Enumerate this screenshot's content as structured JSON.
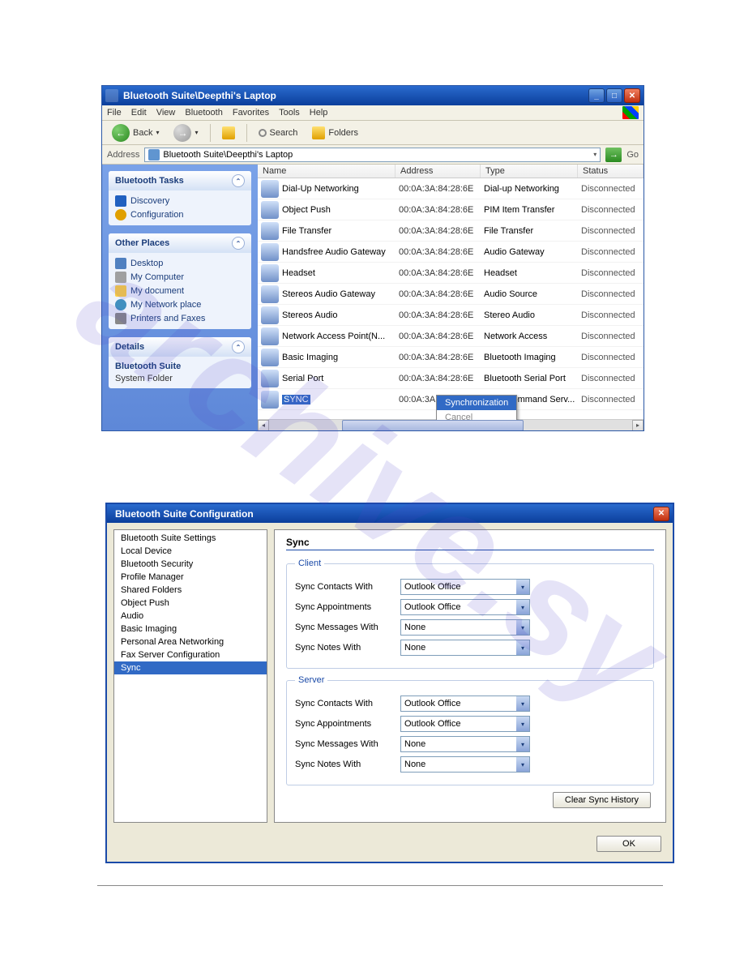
{
  "win1": {
    "title": "Bluetooth Suite\\Deepthi's Laptop",
    "menu": [
      "File",
      "Edit",
      "View",
      "Bluetooth",
      "Favorites",
      "Tools",
      "Help"
    ],
    "toolbar": {
      "back": "Back",
      "search": "Search",
      "folders": "Folders"
    },
    "address": {
      "label": "Address",
      "value": "Bluetooth Suite\\Deepthi's Laptop",
      "go": "Go"
    },
    "side": {
      "tasks": {
        "title": "Bluetooth Tasks",
        "items": [
          "Discovery",
          "Configuration"
        ]
      },
      "places": {
        "title": "Other Places",
        "items": [
          "Desktop",
          "My Computer",
          "My document",
          "My Network place",
          "Printers and Faxes"
        ]
      },
      "details": {
        "title": "Details",
        "name": "Bluetooth Suite",
        "kind": "System Folder"
      }
    },
    "columns": {
      "name": "Name",
      "address": "Address",
      "type": "Type",
      "status": "Status"
    },
    "rows": [
      {
        "name": "Dial-Up Networking",
        "addr": "00:0A:3A:84:28:6E",
        "type": "Dial-up Networking",
        "status": "Disconnected"
      },
      {
        "name": "Object Push",
        "addr": "00:0A:3A:84:28:6E",
        "type": "PIM Item Transfer",
        "status": "Disconnected"
      },
      {
        "name": "File Transfer",
        "addr": "00:0A:3A:84:28:6E",
        "type": "File Transfer",
        "status": "Disconnected"
      },
      {
        "name": "Handsfree Audio Gateway",
        "addr": "00:0A:3A:84:28:6E",
        "type": "Audio Gateway",
        "status": "Disconnected"
      },
      {
        "name": "Headset",
        "addr": "00:0A:3A:84:28:6E",
        "type": "Headset",
        "status": "Disconnected"
      },
      {
        "name": "Stereos Audio Gateway",
        "addr": "00:0A:3A:84:28:6E",
        "type": "Audio Source",
        "status": "Disconnected"
      },
      {
        "name": "Stereos Audio",
        "addr": "00:0A:3A:84:28:6E",
        "type": "Stereo Audio",
        "status": "Disconnected"
      },
      {
        "name": "Network Access Point(N...",
        "addr": "00:0A:3A:84:28:6E",
        "type": "Network Access",
        "status": "Disconnected"
      },
      {
        "name": "Basic Imaging",
        "addr": "00:0A:3A:84:28:6E",
        "type": "Bluetooth Imaging",
        "status": "Disconnected"
      },
      {
        "name": "Serial Port",
        "addr": "00:0A:3A:84:28:6E",
        "type": "Bluetooth Serial Port",
        "status": "Disconnected"
      },
      {
        "name": "SYNC",
        "addr": "00:0A:3A:84:28:6E",
        "type": "Sync Command Serv...",
        "status": "Disconnected",
        "sel": true
      }
    ],
    "context": {
      "sync": "Synchronization",
      "cancel": "Cancel"
    }
  },
  "win2": {
    "title": "Bluetooth Suite Configuration",
    "list": [
      "Bluetooth Suite Settings",
      "Local Device",
      "Bluetooth Security",
      "Profile Manager",
      "Shared Folders",
      "Object Push",
      "Audio",
      "Basic Imaging",
      "Personal Area Networking",
      "Fax Server Configuration",
      "Sync"
    ],
    "selected": 10,
    "panel": {
      "heading": "Sync",
      "client": {
        "legend": "Client",
        "rows": [
          {
            "label": "Sync Contacts With",
            "val": "Outlook Office"
          },
          {
            "label": "Sync Appointments",
            "val": "Outlook Office"
          },
          {
            "label": "Sync Messages With",
            "val": "None"
          },
          {
            "label": "Sync Notes With",
            "val": "None"
          }
        ]
      },
      "server": {
        "legend": "Server",
        "rows": [
          {
            "label": "Sync Contacts With",
            "val": "Outlook Office"
          },
          {
            "label": "Sync Appointments",
            "val": "Outlook Office"
          },
          {
            "label": "Sync Messages With",
            "val": "None"
          },
          {
            "label": "Sync Notes With",
            "val": "None"
          }
        ]
      },
      "clear": "Clear Sync History"
    },
    "ok": "OK"
  }
}
